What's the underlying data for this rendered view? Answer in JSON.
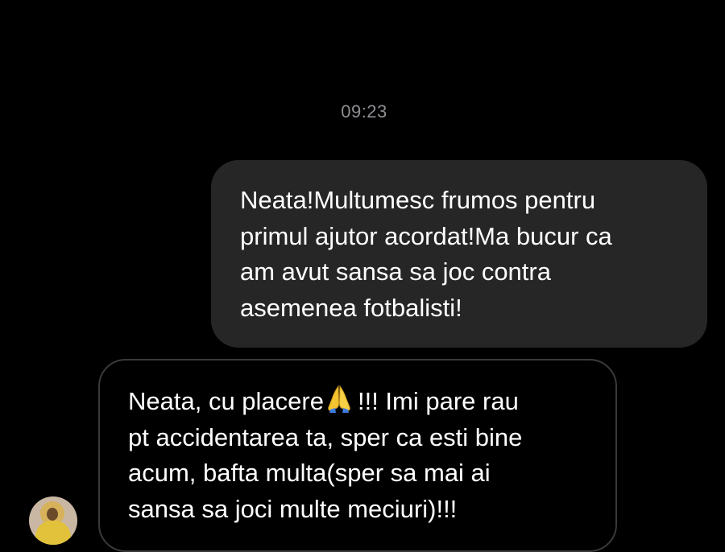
{
  "conversation": {
    "timestamp": "09:23",
    "messages": [
      {
        "direction": "outgoing",
        "lines": [
          "Neata!Multumesc frumos pentru",
          "primul ajutor acordat!Ma bucur ca",
          "am avut sansa sa joc contra",
          "asemenea fotbalisti!"
        ]
      },
      {
        "direction": "incoming",
        "line1_before_emoji": "Neata, cu placere",
        "emoji": "folded-hands",
        "line1_after_emoji": "!!! Imi pare rau",
        "lines": [
          "pt accidentarea ta, sper ca esti bine",
          "acum, bafta multa(sper sa mai ai",
          "sansa sa joci multe meciuri)!!!"
        ]
      }
    ]
  },
  "colors": {
    "background": "#000000",
    "outgoing_bubble": "#262626",
    "incoming_bubble_border": "#3a3a3a",
    "timestamp_text": "#8e8e93",
    "message_text": "#ffffff"
  }
}
